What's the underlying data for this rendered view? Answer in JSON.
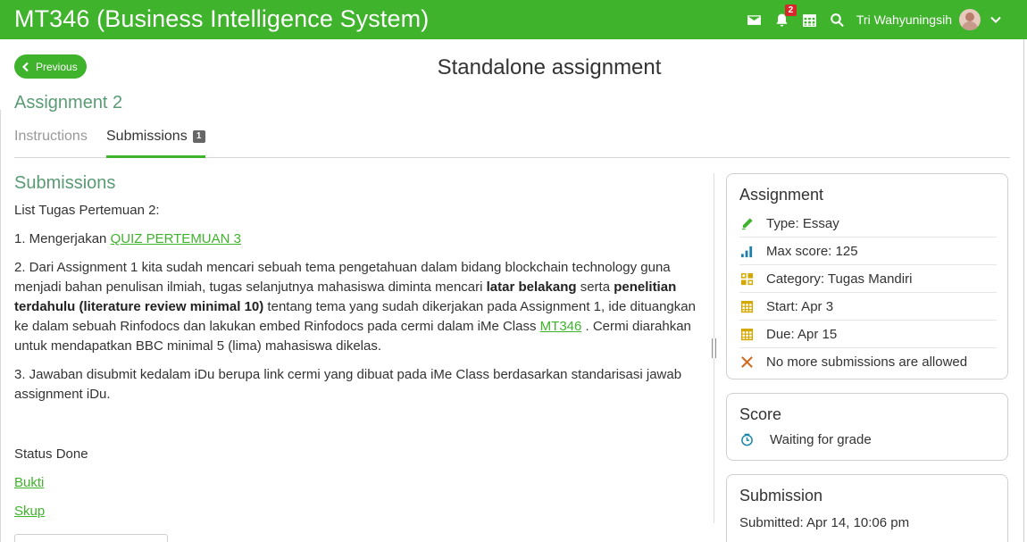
{
  "header": {
    "app_title": "MT346 (Business Intelligence System)",
    "notification_count": "2",
    "user_name": "Tri Wahyuningsih"
  },
  "nav": {
    "previous_label": "Previous",
    "page_title": "Standalone assignment"
  },
  "assignment_title": "Assignment 2",
  "tabs": [
    {
      "label": "Instructions",
      "active": false
    },
    {
      "label": "Submissions",
      "active": true,
      "count": "1"
    }
  ],
  "main": {
    "section_title": "Submissions",
    "intro": "List Tugas Pertemuan 2:",
    "item1_prefix": "1. Mengerjakan ",
    "item1_link": "QUIZ PERTEMUAN 3",
    "item2_part1": "2. Dari Assignment 1 kita sudah mencari sebuah tema pengetahuan dalam bidang blockchain technology guna menjadi bahan penulisan ilmiah, tugas selanjutnya mahasiswa diminta mencari ",
    "item2_bold1": "latar belakang",
    "item2_part2": " serta ",
    "item2_bold2": "penelitian terdahulu (literature review minimal 10)",
    "item2_part3": " tentang tema yang sudah dikerjakan pada Assignment 1, ide dituangkan ke dalam sebuah Rinfodocs dan lakukan embed Rinfodocs pada cermi dalam iMe Class ",
    "item2_link": "MT346",
    "item2_part4": " . Cermi diarahkan untuk mendapatkan BBC minimal 5 (lima) mahasiswa dikelas.",
    "item3": "3. Jawaban disubmit kedalam iDu berupa link cermi yang dibuat pada iMe Class berdasarkan standarisasi jawab assignment iDu.",
    "status": "Status Done",
    "link_bukti": "Bukti",
    "link_skup": "Skup"
  },
  "assignment_card": {
    "title": "Assignment",
    "items": [
      {
        "icon": "pencil-icon",
        "text": "Type: Essay",
        "color": "#3fb32c"
      },
      {
        "icon": "bar-chart-icon",
        "text": "Max score: 125",
        "color": "#1e7fa8"
      },
      {
        "icon": "category-grid-icon",
        "text": "Category: Tugas Mandiri",
        "color": "#d4a800"
      },
      {
        "icon": "calendar-icon",
        "text": "Start: Apr 3",
        "color": "#d4a800"
      },
      {
        "icon": "calendar-icon",
        "text": "Due: Apr 15",
        "color": "#d4a800"
      },
      {
        "icon": "close-x-icon",
        "text": "No more submissions are allowed",
        "color": "#d2691e"
      }
    ]
  },
  "score_card": {
    "title": "Score",
    "status": "Waiting for grade"
  },
  "submission_card": {
    "title": "Submission",
    "submitted": "Submitted: Apr 14, 10:06 pm"
  },
  "colors": {
    "brand_green": "#3fb32c",
    "heading_green": "#5a9a74"
  }
}
